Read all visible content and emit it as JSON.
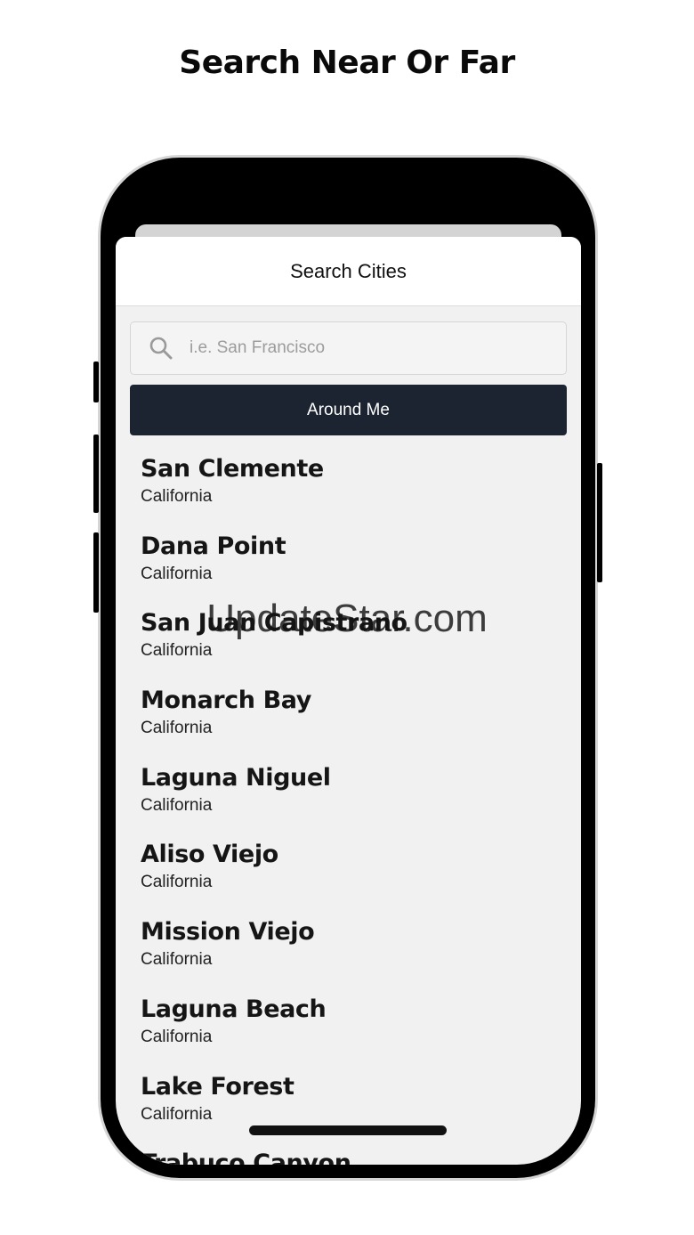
{
  "headline": "Search Near Or Far",
  "sheet": {
    "title": "Search Cities"
  },
  "search": {
    "placeholder": "i.e. San Francisco",
    "value": ""
  },
  "around_me_label": "Around Me",
  "cities": [
    {
      "name": "San Clemente",
      "state": "California"
    },
    {
      "name": "Dana Point",
      "state": "California"
    },
    {
      "name": "San Juan Capistrano",
      "state": "California"
    },
    {
      "name": "Monarch Bay",
      "state": "California"
    },
    {
      "name": "Laguna Niguel",
      "state": "California"
    },
    {
      "name": "Aliso Viejo",
      "state": "California"
    },
    {
      "name": "Mission Viejo",
      "state": "California"
    },
    {
      "name": "Laguna Beach",
      "state": "California"
    },
    {
      "name": "Lake Forest",
      "state": "California"
    },
    {
      "name": "Trabuco Canyon",
      "state": ""
    }
  ],
  "watermark": "UpdateStar.com",
  "colors": {
    "button_bg": "#1c2432",
    "sheet_bg": "#f1f1f1",
    "phone_frame": "#000000"
  },
  "icons": {
    "search": "search-icon"
  }
}
